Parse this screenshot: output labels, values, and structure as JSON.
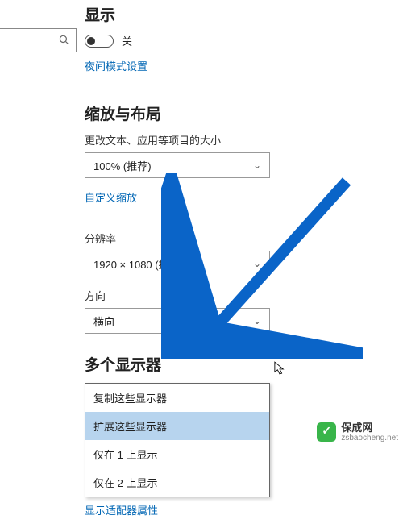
{
  "header": {
    "title": "显示"
  },
  "brightness": {
    "toggle_state": "off",
    "toggle_label": "关",
    "night_mode_link": "夜间模式设置"
  },
  "scale": {
    "section_title": "缩放与布局",
    "text_size_label": "更改文本、应用等项目的大小",
    "text_size_value": "100% (推荐)",
    "custom_zoom_link": "自定义缩放",
    "resolution_label": "分辨率",
    "resolution_value": "1920 × 1080 (推荐)",
    "orientation_label": "方向",
    "orientation_value": "横向"
  },
  "multi": {
    "section_title": "多个显示器",
    "options": [
      "复制这些显示器",
      "扩展这些显示器",
      "仅在 1 上显示",
      "仅在 2 上显示"
    ],
    "selected_index": 1,
    "adapter_link": "显示适配器属性"
  },
  "watermark": {
    "brand": "保成网",
    "url": "zsbaocheng.net"
  },
  "accent_color": "#0a64c8"
}
